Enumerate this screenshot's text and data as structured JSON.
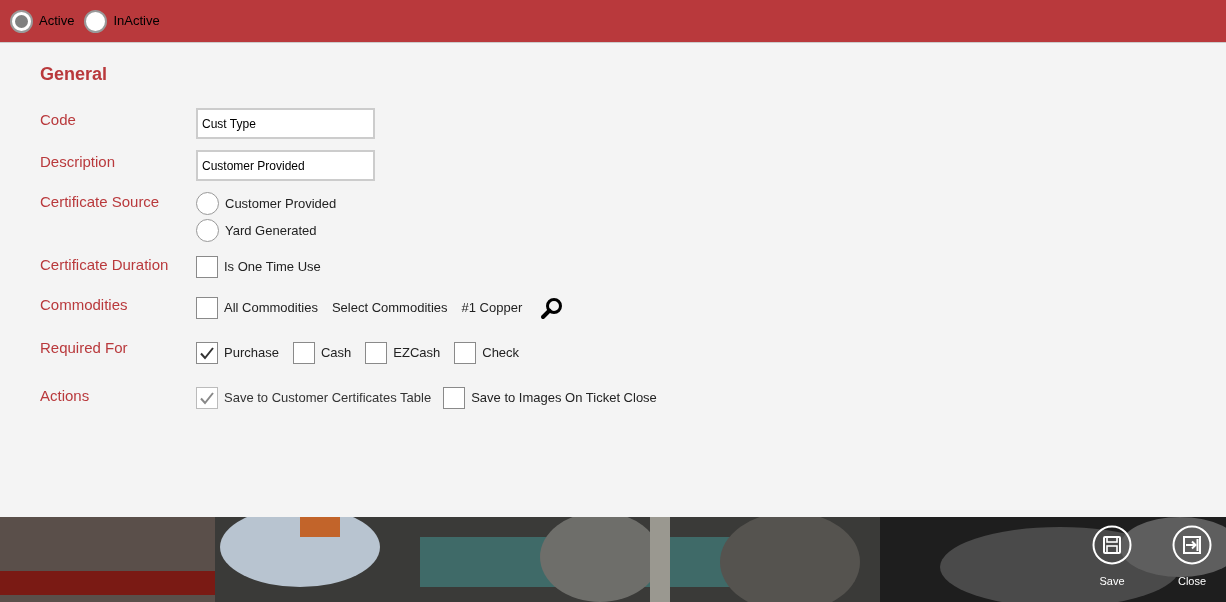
{
  "status_options": [
    {
      "label": "Active",
      "selected": true
    },
    {
      "label": "InActive",
      "selected": false
    }
  ],
  "section_title": "General",
  "fields": [
    {
      "label": "Code",
      "value": "Cust Type"
    },
    {
      "label": "Description",
      "value": "Customer Provided"
    }
  ],
  "certificate_source": {
    "label": "Certificate Source",
    "options": [
      {
        "label": "Customer Provided",
        "selected": false
      },
      {
        "label": "Yard Generated",
        "selected": false
      }
    ]
  },
  "certificate_duration": {
    "label": "Certificate Duration",
    "options": [
      {
        "label": "Is One Time Use",
        "checked": false
      }
    ]
  },
  "commodities": {
    "label": "Commodities",
    "all": {
      "label": "All Commodities",
      "checked": false
    },
    "select_label": "Select Commodities",
    "selected_value": "#1 Copper"
  },
  "required_for": {
    "label": "Required For",
    "options": [
      {
        "label": "Purchase",
        "checked": true
      },
      {
        "label": "Cash",
        "checked": false
      },
      {
        "label": "EZCash",
        "checked": false
      },
      {
        "label": "Check",
        "checked": false
      }
    ]
  },
  "actions": {
    "label": "Actions",
    "options": [
      {
        "label": "Save to Customer Certificates Table",
        "checked": true,
        "disabled": true
      },
      {
        "label": "Save to Images On Ticket Close",
        "checked": false,
        "disabled": false
      }
    ]
  },
  "footer_buttons": [
    {
      "kind": "save",
      "label": "Save"
    },
    {
      "kind": "close",
      "label": "Close"
    }
  ]
}
